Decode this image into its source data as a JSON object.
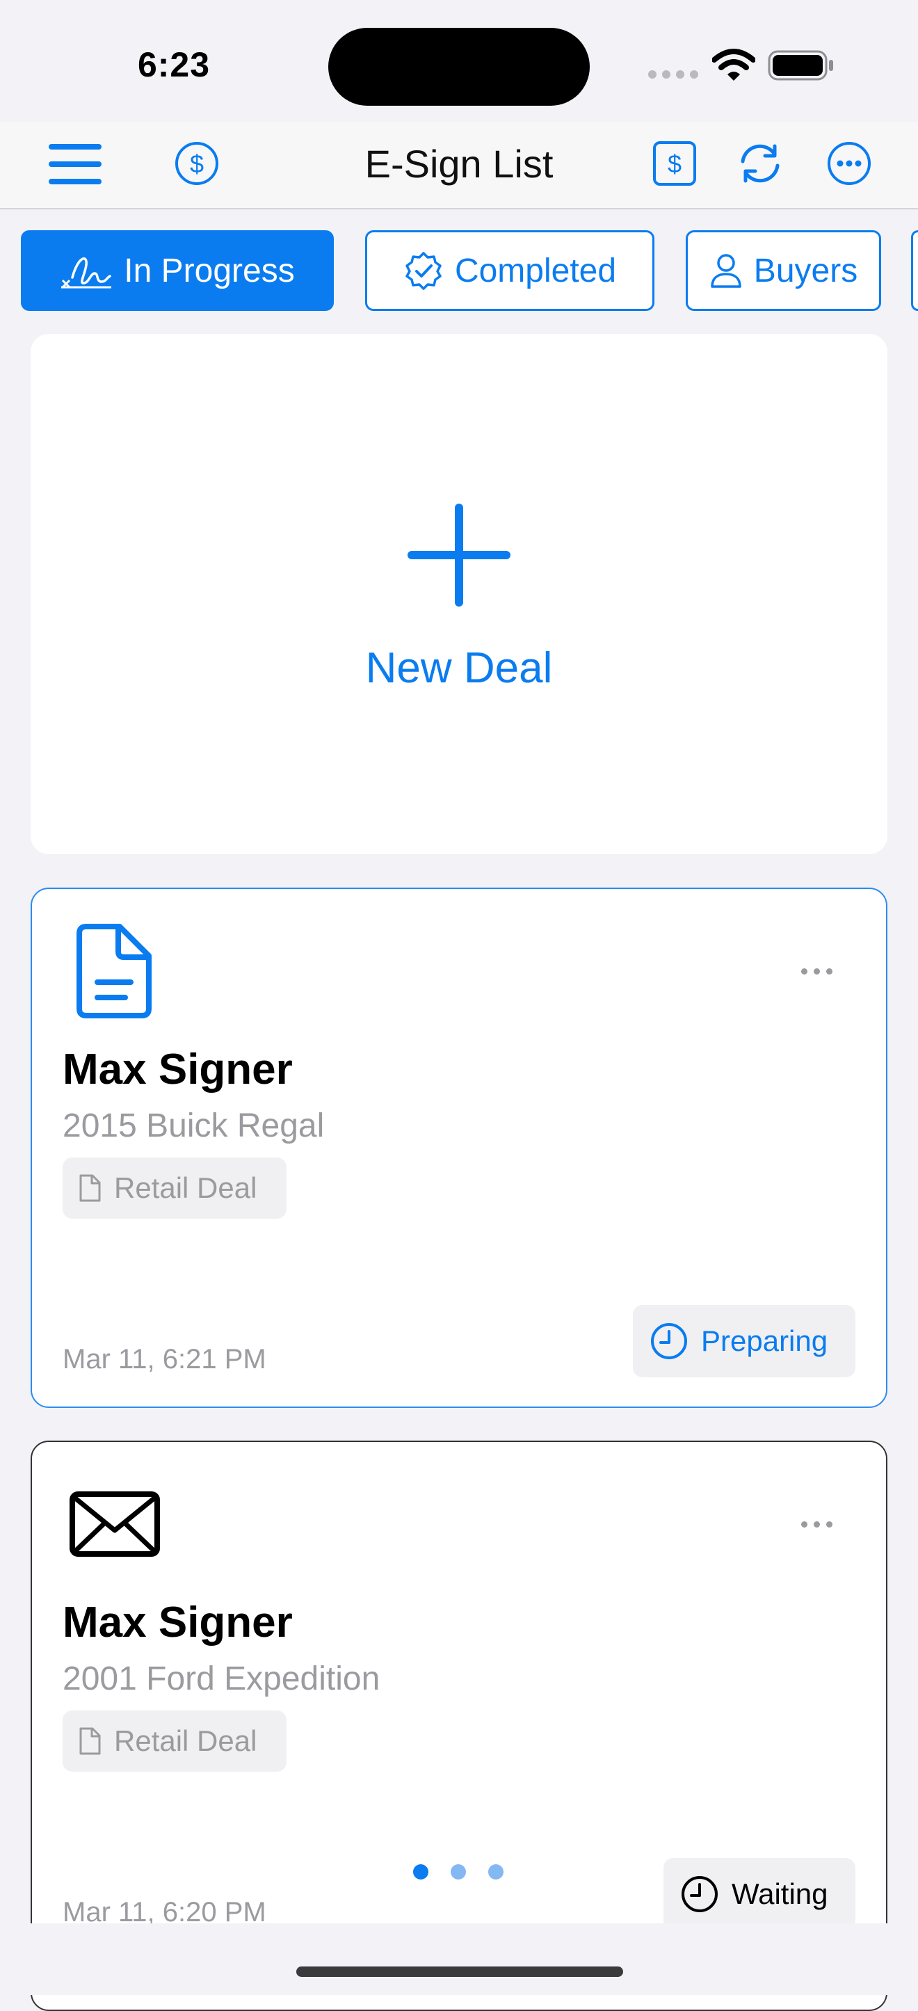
{
  "status_bar": {
    "time": "6:23"
  },
  "nav": {
    "title": "E-Sign List"
  },
  "filters": [
    {
      "label": "In Progress",
      "icon": "signature-icon",
      "active": true
    },
    {
      "label": "Completed",
      "icon": "checkmark-seal-icon",
      "active": false
    },
    {
      "label": "Buyers",
      "icon": "person-icon",
      "active": false
    }
  ],
  "new_deal": {
    "label": "New Deal"
  },
  "deals": [
    {
      "buyer": "Max Signer",
      "vehicle": "2015 Buick Regal",
      "deal_type": "Retail Deal",
      "date": "Mar 11, 6:21 PM",
      "status": "Preparing",
      "status_color": "#0a7cf0",
      "icon": "document-icon"
    },
    {
      "buyer": "Max Signer",
      "vehicle": "2001 Ford Expedition",
      "deal_type": "Retail Deal",
      "date": "Mar 11, 6:20 PM",
      "status": "Waiting",
      "status_color": "#000000",
      "icon": "envelope-icon"
    }
  ],
  "pagination": {
    "count": 3,
    "current": 1
  },
  "colors": {
    "accent": "#0a7cf0",
    "secondary_text": "#9a9a9f"
  }
}
